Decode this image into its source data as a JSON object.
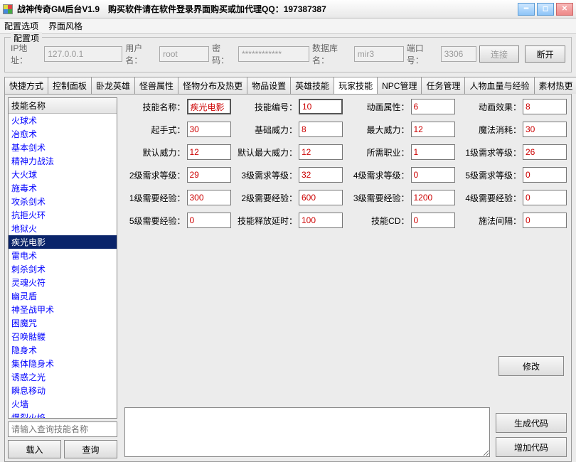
{
  "titlebar": {
    "title": "战神传奇GM后台V1.9",
    "subtitle": "购买软件请在软件登录界面购买或加代理QQ：197387387"
  },
  "menubar": {
    "items": [
      "配置选项",
      "界面风格"
    ]
  },
  "config": {
    "legend": "配置项",
    "ip_label": "IP地址：",
    "ip": "127.0.0.1",
    "user_label": "用户名：",
    "user": "root",
    "pass_label": "密码：",
    "pass": "************",
    "db_label": "数据库名：",
    "db": "mir3",
    "port_label": "端口号：",
    "port": "3306",
    "connect": "连接",
    "disconnect": "断开"
  },
  "tabs": [
    "快捷方式",
    "控制面板",
    "卧龙英雄",
    "怪兽属性",
    "怪物分布及热更",
    "物品设置",
    "英雄技能",
    "玩家技能",
    "NPC管理",
    "任务管理",
    "人物血量与经验",
    "素材热更"
  ],
  "active_tab": 7,
  "skills": {
    "header": "技能名称",
    "items": [
      "火球术",
      "冶愈术",
      "基本剑术",
      "精神力战法",
      "大火球",
      "施毒术",
      "攻杀剑术",
      "抗拒火环",
      "地狱火",
      "疾光电影",
      "雷电术",
      "刺杀剑术",
      "灵魂火符",
      "幽灵盾",
      "神圣战甲术",
      "困魔咒",
      "召唤骷髅",
      "隐身术",
      "集体隐身术",
      "诱惑之光",
      "瞬息移动",
      "火墙",
      "爆裂火焰"
    ],
    "selected": 9
  },
  "search": {
    "placeholder": "请输入查询技能名称",
    "load": "载入",
    "query": "查询"
  },
  "fields": {
    "r0": [
      {
        "l": "技能名称：",
        "v": "疾光电影",
        "main": true
      },
      {
        "l": "技能编号：",
        "v": "10",
        "main": true
      },
      {
        "l": "动画属性：",
        "v": "6"
      },
      {
        "l": "动画效果：",
        "v": "8"
      }
    ],
    "r1": [
      {
        "l": "起手式：",
        "v": "30"
      },
      {
        "l": "基础威力：",
        "v": "8"
      },
      {
        "l": "最大威力：",
        "v": "12"
      },
      {
        "l": "魔法消耗：",
        "v": "30"
      }
    ],
    "r2": [
      {
        "l": "默认威力：",
        "v": "12"
      },
      {
        "l": "默认最大威力：",
        "v": "12"
      },
      {
        "l": "所需职业：",
        "v": "1"
      },
      {
        "l": "1级需求等级：",
        "v": "26"
      }
    ],
    "r3": [
      {
        "l": "2级需求等级：",
        "v": "29"
      },
      {
        "l": "3级需求等级：",
        "v": "32"
      },
      {
        "l": "4级需求等级：",
        "v": "0"
      },
      {
        "l": "5级需求等级：",
        "v": "0"
      }
    ],
    "r4": [
      {
        "l": "1级需要经验：",
        "v": "300"
      },
      {
        "l": "2级需要经验：",
        "v": "600"
      },
      {
        "l": "3级需要经验：",
        "v": "1200"
      },
      {
        "l": "4级需要经验：",
        "v": "0"
      }
    ],
    "r5": [
      {
        "l": "5级需要经验：",
        "v": "0"
      },
      {
        "l": "技能释放延时：",
        "v": "100"
      },
      {
        "l": "技能CD：",
        "v": "0"
      },
      {
        "l": "施法间隔：",
        "v": "0"
      }
    ]
  },
  "buttons": {
    "modify": "修改",
    "gencode": "生成代码",
    "addcode": "增加代码"
  }
}
